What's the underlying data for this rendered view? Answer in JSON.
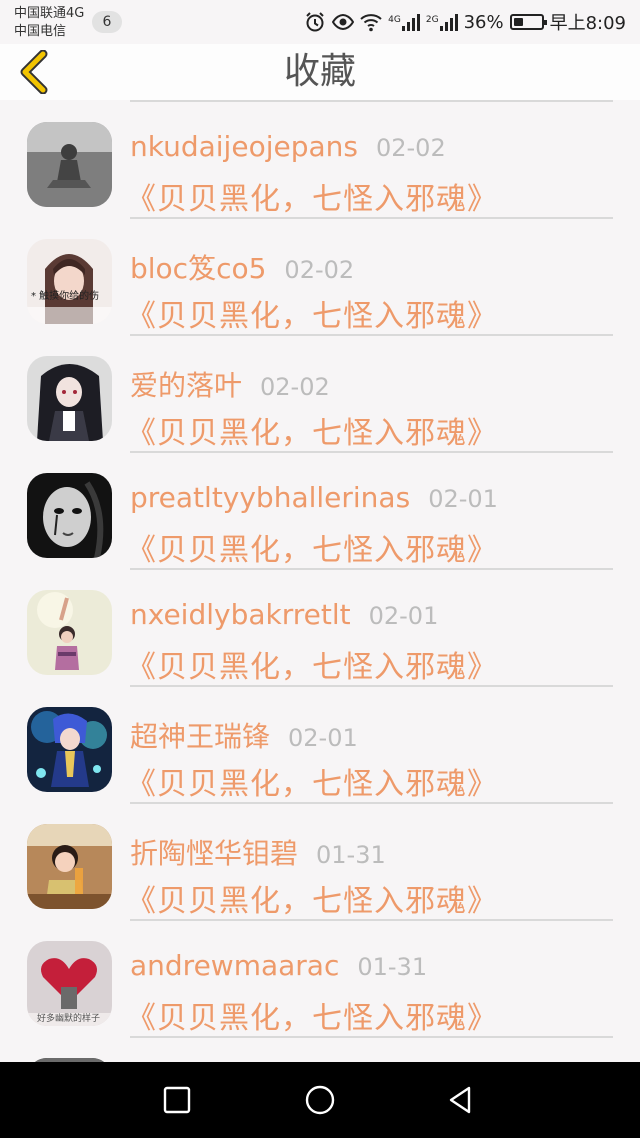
{
  "status_bar": {
    "carrier1": "中国联通4G",
    "carrier2": "中国电信",
    "badge": "6",
    "net_tag1": "4G",
    "net_tag2": "2G",
    "battery": "36%",
    "battery_level": 0.36,
    "time": "早上8:09"
  },
  "header": {
    "title": "收藏"
  },
  "items": [
    {
      "name": "nkudaijeojepans",
      "date": "02-02",
      "subtitle": "《贝贝黑化，七怪入邪魂》",
      "avatar_style": "bw-photo"
    },
    {
      "name": "bloc笈co5",
      "date": "02-02",
      "subtitle": "《贝贝黑化，七怪入邪魂》",
      "avatar_style": "portrait-light",
      "avatar_caption": "* 触摸你给的伤"
    },
    {
      "name": "爱的落叶",
      "date": "02-02",
      "subtitle": "《贝贝黑化，七怪入邪魂》",
      "avatar_style": "anime-dark"
    },
    {
      "name": "preatltyybhallerinas",
      "date": "02-01",
      "subtitle": "《贝贝黑化，七怪入邪魂》",
      "avatar_style": "mask-dark"
    },
    {
      "name": "nxeidlybakrretlt",
      "date": "02-01",
      "subtitle": "《贝贝黑化，七怪入邪魂》",
      "avatar_style": "girl-pale"
    },
    {
      "name": "超神王瑞锋",
      "date": "02-01",
      "subtitle": "《贝贝黑化，七怪入邪魂》",
      "avatar_style": "anime-blue"
    },
    {
      "name": "折陶悭华钼碧",
      "date": "01-31",
      "subtitle": "《贝贝黑化，七怪入邪魂》",
      "avatar_style": "child-warm"
    },
    {
      "name": "andrewmaarac",
      "date": "01-31",
      "subtitle": "《贝贝黑化，七怪入邪魂》",
      "avatar_style": "heart-red",
      "avatar_caption": "好多幽默的样子"
    }
  ],
  "colors": {
    "accent": "#ee9a6a",
    "date": "#bcbcbc",
    "back_icon": "#f2c400"
  },
  "icons": {
    "back": "chevron-left-icon",
    "nav": [
      "square-icon",
      "circle-icon",
      "triangle-back-icon"
    ]
  }
}
